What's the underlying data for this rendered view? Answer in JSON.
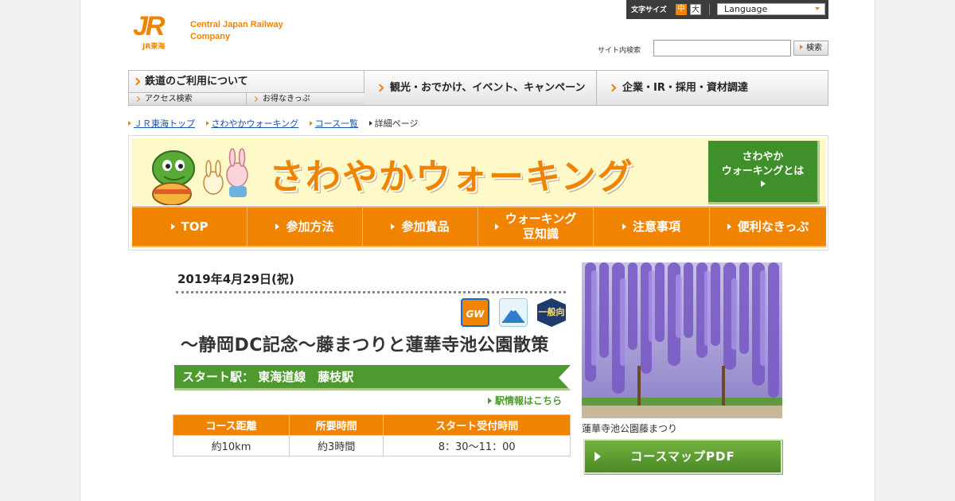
{
  "header": {
    "company_en": "Central Japan Railway Company",
    "logo_mark": "JR",
    "logo_sub": "JR東海",
    "font_size_label": "文字サイズ",
    "font_size_mid": "中",
    "font_size_large": "大",
    "language_label": "Language",
    "site_search_label": "サイト内検索",
    "search_value": "",
    "search_button": "検索"
  },
  "gnav": {
    "rail": "鉄道のご利用について",
    "access": "アクセス検索",
    "tickets": "お得なきっぷ",
    "sightseeing": "観光・おでかけ、イベント、キャンペーン",
    "corporate": "企業・IR・採用・資材調達"
  },
  "breadcrumb": {
    "home": "ＪＲ東海トップ",
    "walking": "さわやかウォーキング",
    "courses": "コース一覧",
    "current": "詳細ページ"
  },
  "banner": {
    "title": "さわやかウォーキング",
    "whatis_line1": "さわやか",
    "whatis_line2": "ウォーキングとは",
    "nav": [
      "TOP",
      "参加方法",
      "参加賞品",
      "ウォーキング\n豆知識",
      "注意事項",
      "便利なきっぷ"
    ]
  },
  "course": {
    "date": "2019年4月29日(祝)",
    "badges": {
      "gw": "GW",
      "general": "一般向"
    },
    "title": "～静岡DC記念～藤まつりと蓮華寺池公園散策",
    "start_station": "スタート駅：  東海道線　藤枝駅",
    "station_info_link": "駅情報はこちら",
    "table_headers": [
      "コース距離",
      "所要時間",
      "スタート受付時間"
    ],
    "table_values": [
      "約10km",
      "約3時間",
      "8：30～11：00"
    ],
    "photo_caption": "蓮華寺池公園藤まつり",
    "pdf_button": "コースマップPDF"
  },
  "colors": {
    "accent": "#f08300",
    "green": "#4e9a2f",
    "banner_bg": "#fdf9c8"
  }
}
